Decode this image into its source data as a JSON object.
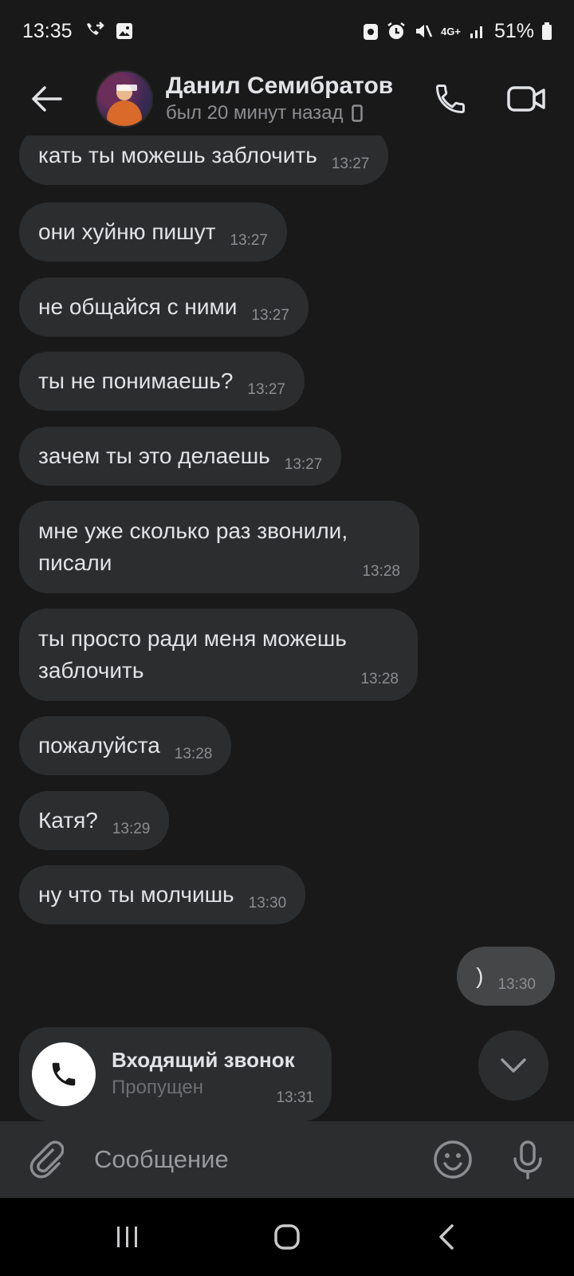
{
  "status_bar": {
    "time": "13:35",
    "network": "4G+",
    "battery": "51%"
  },
  "header": {
    "contact_name": "Данил Семибратов",
    "last_seen": "был 20 минут назад"
  },
  "messages": [
    {
      "text": "кать ты можешь заблочить",
      "time": "13:27",
      "direction": "incoming"
    },
    {
      "text": "они хуйню пишут",
      "time": "13:27",
      "direction": "incoming"
    },
    {
      "text": "не общайся с ними",
      "time": "13:27",
      "direction": "incoming"
    },
    {
      "text": "ты не понимаешь?",
      "time": "13:27",
      "direction": "incoming"
    },
    {
      "text": "зачем ты это делаешь",
      "time": "13:27",
      "direction": "incoming"
    },
    {
      "text_line1": "мне уже сколько раз звонили,",
      "text_line2": "писали",
      "time": "13:28",
      "direction": "incoming"
    },
    {
      "text_line1": "ты просто ради меня можешь",
      "text_line2": "заблочить",
      "time": "13:28",
      "direction": "incoming"
    },
    {
      "text": "пожалуйста",
      "time": "13:28",
      "direction": "incoming"
    },
    {
      "text": "Катя?",
      "time": "13:29",
      "direction": "incoming"
    },
    {
      "text": "ну что ты молчишь",
      "time": "13:30",
      "direction": "incoming"
    },
    {
      "text": ")",
      "time": "13:30",
      "direction": "outgoing"
    }
  ],
  "missed_call": {
    "title": "Входящий звонок",
    "status": "Пропущен",
    "time": "13:31"
  },
  "composer": {
    "placeholder": "Сообщение"
  },
  "icons": {
    "back": "arrow-left-icon",
    "call": "phone-icon",
    "video": "video-camera-icon",
    "attach": "paperclip-icon",
    "emoji": "smiley-icon",
    "voice": "microphone-icon",
    "scroll": "chevron-down-icon"
  }
}
